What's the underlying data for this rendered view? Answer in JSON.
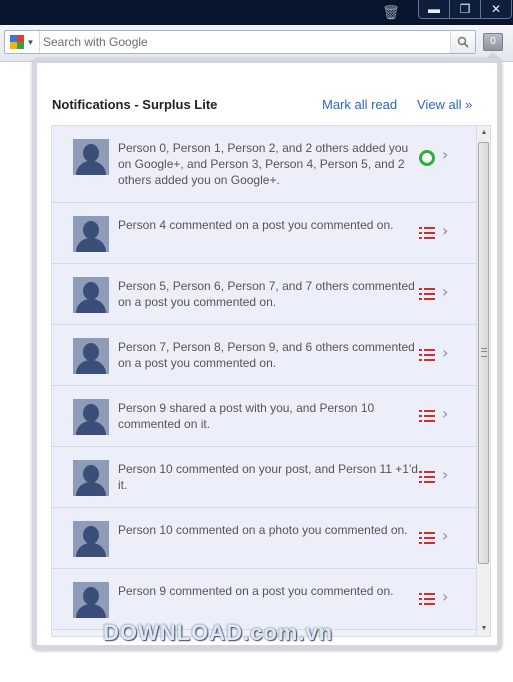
{
  "window": {
    "buttons": {
      "minimize": "▬",
      "restore": "❐",
      "close": "✕"
    }
  },
  "toolbar": {
    "search_placeholder": "Search with Google",
    "extension_badge": "0"
  },
  "popup": {
    "title": "Notifications - Surplus Lite",
    "mark_all_read": "Mark all read",
    "view_all": "View all »"
  },
  "notifications": [
    {
      "text": "Person 0, Person 1, Person 2, and 2 others added you on Google+, and Person 3, Person 4, Person 5, and 2 others added you on Google+.",
      "icon": "circle-icon"
    },
    {
      "text": "Person 4 commented on a post you commented on.",
      "icon": "list-icon"
    },
    {
      "text": "Person 5, Person 6, Person 7, and 7 others commented on a post you commented on.",
      "icon": "list-icon"
    },
    {
      "text": "Person 7, Person 8, Person 9, and 6 others commented on a post you commented on.",
      "icon": "list-icon"
    },
    {
      "text": "Person 9 shared a post with you, and Person 10 commented on it.",
      "icon": "list-icon"
    },
    {
      "text": "Person 10 commented on your post, and Person 11 +1'd it.",
      "icon": "list-icon"
    },
    {
      "text": "Person 10 commented on a photo you commented on.",
      "icon": "list-icon"
    },
    {
      "text": "Person 9 commented on a post you commented on.",
      "icon": "list-icon"
    }
  ],
  "watermark": {
    "main": "DOWNLOAD",
    "suffix": ".com.vn"
  },
  "colors": {
    "link": "#2a66c8",
    "accent_green": "#2eac3c",
    "accent_red": "#d02d2d",
    "titlebar": "#07162e"
  }
}
